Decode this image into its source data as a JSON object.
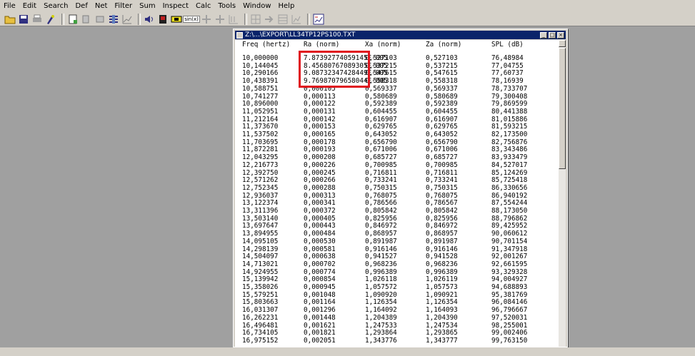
{
  "menubar": [
    "File",
    "Edit",
    "Search",
    "Def",
    "Net",
    "Filter",
    "Sum",
    "Inspect",
    "Calc",
    "Tools",
    "Window",
    "Help"
  ],
  "toolbar": {
    "icons": [
      "open-folder-icon",
      "save-icon",
      "print-icon",
      "wizard-icon",
      "new-doc-icon",
      "copy-icon",
      "capacitor-icon",
      "filter-icon",
      "graph-icon",
      "speaker-icon",
      "red-box-icon",
      "sine-icon",
      "plus-icon",
      "plus2-icon",
      "grid-icon",
      "grid2-icon",
      "arrow-icon",
      "grid3-icon",
      "grid4-icon",
      "chart-icon"
    ],
    "sine_label": "sin(x)"
  },
  "window": {
    "title": "Z:\\...\\EXPORT\\LL34TP12PS100.TXT",
    "headers": [
      "Freq (hertz)",
      "Ra (norm)",
      "Xa (norm)",
      "Za (norm)",
      "SPL (dB)"
    ],
    "rows": [
      [
        "10,000000",
        "7.87392774059145E-005",
        "0,527103",
        "0,527103",
        "76,48984"
      ],
      [
        "10,144045",
        "8.45680767089305E-005",
        "0,537215",
        "0,537215",
        "77,04755"
      ],
      [
        "10,290166",
        "9.08732347428449E-005",
        "0,547615",
        "0,547615",
        "77,60737"
      ],
      [
        "10,438391",
        "9.76987079658044E-005",
        "0,558318",
        "0,558318",
        "78,16939"
      ],
      [
        "10,588751",
        "0,000105",
        "0,569337",
        "0,569337",
        "78,733707"
      ],
      [
        "10,741277",
        "0,000113",
        "0,580689",
        "0,580689",
        "79,300408"
      ],
      [
        "10,896000",
        "0,000122",
        "0,592389",
        "0,592389",
        "79,869599"
      ],
      [
        "11,052951",
        "0,000131",
        "0,604455",
        "0,604455",
        "80,441388"
      ],
      [
        "11,212164",
        "0,000142",
        "0,616907",
        "0,616907",
        "81,015886"
      ],
      [
        "11,373670",
        "0,000153",
        "0,629765",
        "0,629765",
        "81,593215"
      ],
      [
        "11,537502",
        "0,000165",
        "0,643052",
        "0,643052",
        "82,173500"
      ],
      [
        "11,703695",
        "0,000178",
        "0,656790",
        "0,656790",
        "82,756876"
      ],
      [
        "11,872281",
        "0,000193",
        "0,671006",
        "0,671006",
        "83,343486"
      ],
      [
        "12,043295",
        "0,000208",
        "0,685727",
        "0,685727",
        "83,933479"
      ],
      [
        "12,216773",
        "0,000226",
        "0,700985",
        "0,700985",
        "84,527017"
      ],
      [
        "12,392750",
        "0,000245",
        "0,716811",
        "0,716811",
        "85,124269"
      ],
      [
        "12,571262",
        "0,000266",
        "0,733241",
        "0,733241",
        "85,725418"
      ],
      [
        "12,752345",
        "0,000288",
        "0,750315",
        "0,750315",
        "86,330656"
      ],
      [
        "12,936037",
        "0,000313",
        "0,768075",
        "0,768075",
        "86,940192"
      ],
      [
        "13,122374",
        "0,000341",
        "0,786566",
        "0,786567",
        "87,554244"
      ],
      [
        "13,311396",
        "0,000372",
        "0,805842",
        "0,805842",
        "88,173050"
      ],
      [
        "13,503140",
        "0,000405",
        "0,825956",
        "0,825956",
        "88,796862"
      ],
      [
        "13,697647",
        "0,000443",
        "0,846972",
        "0,846972",
        "89,425952"
      ],
      [
        "13,894955",
        "0,000484",
        "0,868957",
        "0,868957",
        "90,060612"
      ],
      [
        "14,095105",
        "0,000530",
        "0,891987",
        "0,891987",
        "90,701154"
      ],
      [
        "14,298139",
        "0,000581",
        "0,916146",
        "0,916146",
        "91,347918"
      ],
      [
        "14,504097",
        "0,000638",
        "0,941527",
        "0,941528",
        "92,001267"
      ],
      [
        "14,713021",
        "0,000702",
        "0,968236",
        "0,968236",
        "92,661595"
      ],
      [
        "14,924955",
        "0,000774",
        "0,996389",
        "0,996389",
        "93,329328"
      ],
      [
        "15,139942",
        "0,000854",
        "1,026118",
        "1,026119",
        "94,004927"
      ],
      [
        "15,358026",
        "0,000945",
        "1,057572",
        "1,057573",
        "94,688893"
      ],
      [
        "15,579251",
        "0,001048",
        "1,090920",
        "1,090921",
        "95,381769"
      ],
      [
        "15,803663",
        "0,001164",
        "1,126354",
        "1,126354",
        "96,084146"
      ],
      [
        "16,031307",
        "0,001296",
        "1,164092",
        "1,164093",
        "96,796667"
      ],
      [
        "16,262231",
        "0,001448",
        "1,204389",
        "1,204390",
        "97,520031"
      ],
      [
        "16,496481",
        "0,001621",
        "1,247533",
        "1,247534",
        "98,255001"
      ],
      [
        "16,734105",
        "0,001821",
        "1,293864",
        "1,293865",
        "99,002406"
      ],
      [
        "16,975152",
        "0,002051",
        "1,343776",
        "1,343777",
        "99,763150"
      ]
    ]
  }
}
